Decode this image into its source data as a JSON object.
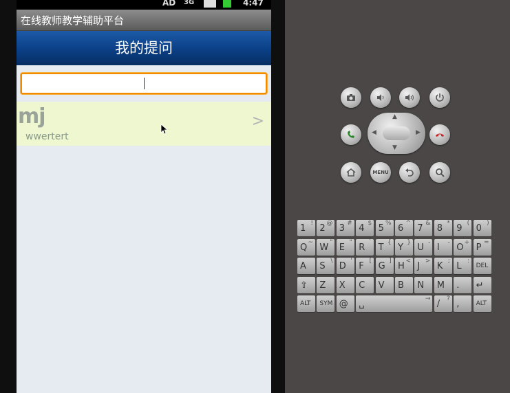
{
  "status_bar": {
    "left_icon_text": "AD",
    "signal_text": "3G",
    "time": "4:47"
  },
  "app": {
    "window_title": "在线教师教学辅助平台",
    "page_title": "我的提问",
    "search": {
      "value": "",
      "placeholder": ""
    }
  },
  "list": {
    "items": [
      {
        "title": "mj",
        "subtitle": "wwertert",
        "arrow": ">"
      }
    ]
  },
  "emulator": {
    "buttons": [
      {
        "name": "camera",
        "icon": "camera-icon"
      },
      {
        "name": "volume-down",
        "icon": "volume-down-icon"
      },
      {
        "name": "volume-up",
        "icon": "volume-up-icon"
      },
      {
        "name": "power",
        "icon": "power-icon"
      },
      {
        "name": "call",
        "icon": "call-icon"
      },
      {
        "name": "end-call",
        "icon": "end-call-icon"
      },
      {
        "name": "home",
        "icon": "home-icon"
      },
      {
        "name": "menu",
        "icon": "menu-icon",
        "label": "MENU"
      },
      {
        "name": "back",
        "icon": "back-icon"
      },
      {
        "name": "search",
        "icon": "search-icon"
      }
    ],
    "keyboard": {
      "rows": [
        [
          [
            "1",
            "!"
          ],
          [
            "2",
            "@"
          ],
          [
            "3",
            "#"
          ],
          [
            "4",
            "$"
          ],
          [
            "5",
            "%"
          ],
          [
            "6",
            "^"
          ],
          [
            "7",
            "&"
          ],
          [
            "8",
            "*"
          ],
          [
            "9",
            "("
          ],
          [
            "0",
            ")"
          ]
        ],
        [
          [
            "Q",
            "~"
          ],
          [
            "W",
            "\""
          ],
          [
            "E",
            "\""
          ],
          [
            "R",
            "`"
          ],
          [
            "T",
            "{"
          ],
          [
            "Y",
            "}"
          ],
          [
            "U",
            "-"
          ],
          [
            "I",
            "-"
          ],
          [
            "O",
            "+"
          ],
          [
            "P",
            "="
          ]
        ],
        [
          [
            "A",
            ""
          ],
          [
            "S",
            "\\"
          ],
          [
            "D",
            "'"
          ],
          [
            "F",
            "["
          ],
          [
            "G",
            "]"
          ],
          [
            "H",
            "<"
          ],
          [
            "J",
            ">"
          ],
          [
            "K",
            ";"
          ],
          [
            "L",
            ":"
          ],
          [
            "DEL",
            ""
          ]
        ],
        [
          [
            "⇧",
            ""
          ],
          [
            "Z",
            ""
          ],
          [
            "X",
            ""
          ],
          [
            "C",
            ""
          ],
          [
            "V",
            ""
          ],
          [
            "B",
            ""
          ],
          [
            "N",
            ""
          ],
          [
            "M",
            ""
          ],
          [
            ".",
            ""
          ],
          [
            "↵",
            ""
          ]
        ],
        [
          [
            "ALT",
            ""
          ],
          [
            "SYM",
            ""
          ],
          [
            "@",
            ""
          ],
          [
            "␣",
            "→"
          ],
          [
            "/",
            "?"
          ],
          [
            ",",
            ""
          ],
          [
            "ALT",
            ""
          ]
        ]
      ]
    }
  }
}
